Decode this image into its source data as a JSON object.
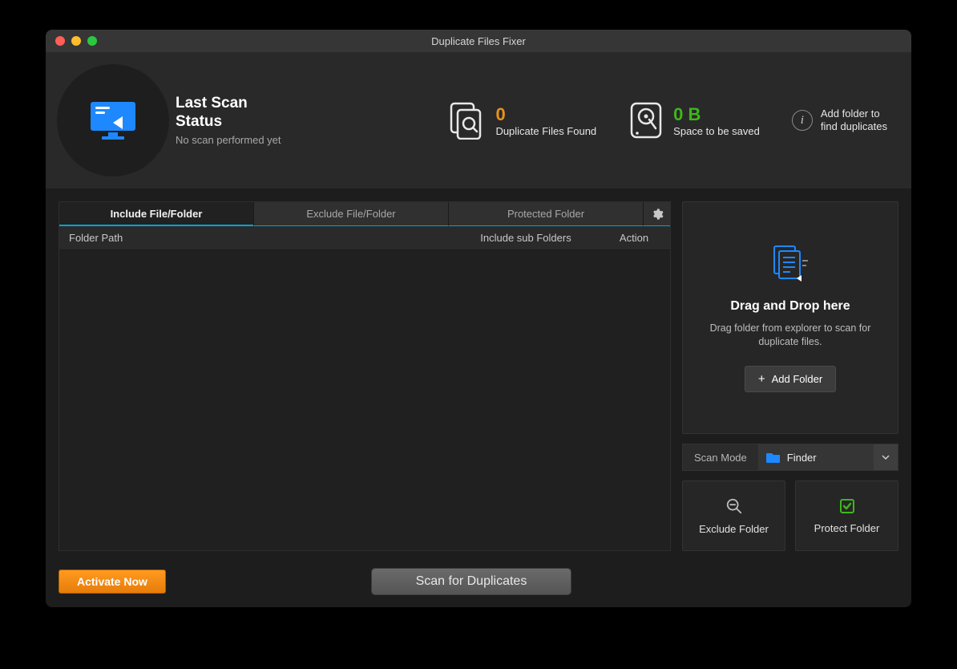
{
  "window": {
    "title": "Duplicate Files Fixer"
  },
  "header": {
    "status_title_line1": "Last Scan",
    "status_title_line2": "Status",
    "status_subtitle": "No scan performed yet",
    "duplicates_value": "0",
    "duplicates_label": "Duplicate Files Found",
    "space_value": "0 B",
    "space_label": "Space to be saved",
    "info_line1": "Add folder to",
    "info_line2": "find duplicates"
  },
  "tabs": {
    "include": "Include File/Folder",
    "exclude": "Exclude File/Folder",
    "protected": "Protected Folder"
  },
  "columns": {
    "path": "Folder Path",
    "sub": "Include sub Folders",
    "action": "Action"
  },
  "drop": {
    "title": "Drag and Drop here",
    "subtitle": "Drag folder from explorer to scan for duplicate files.",
    "add_btn": "Add Folder"
  },
  "scanmode": {
    "label": "Scan Mode",
    "selected": "Finder"
  },
  "actions": {
    "exclude": "Exclude Folder",
    "protect": "Protect Folder"
  },
  "footer": {
    "activate": "Activate Now",
    "scan": "Scan for Duplicates"
  }
}
